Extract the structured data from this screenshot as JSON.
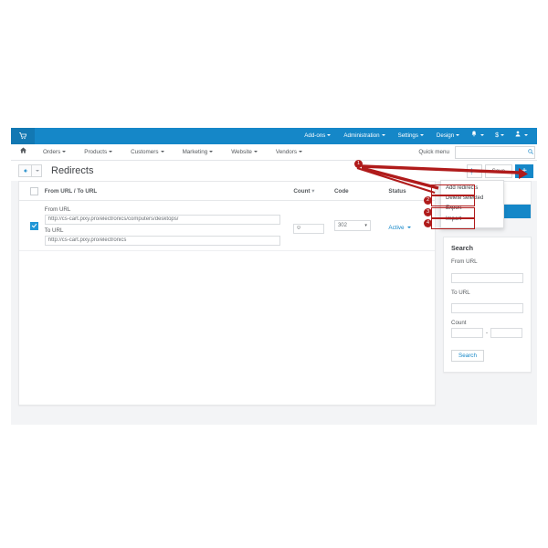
{
  "topbar": {
    "logo_icon": "shopping-cart-icon",
    "menus": [
      {
        "label": "Add-ons",
        "caret": true
      },
      {
        "label": "Administration",
        "caret": true
      },
      {
        "label": "Settings",
        "caret": true
      },
      {
        "label": "Design",
        "caret": true
      }
    ],
    "icons": [
      {
        "name": "bell-icon",
        "glyph": "⚑"
      },
      {
        "name": "currency-icon",
        "glyph": "$"
      },
      {
        "name": "user-icon",
        "glyph": "♟"
      }
    ]
  },
  "mainnav": {
    "home_icon": "home-icon",
    "items": [
      {
        "label": "Orders"
      },
      {
        "label": "Products"
      },
      {
        "label": "Customers"
      },
      {
        "label": "Marketing"
      },
      {
        "label": "Website"
      },
      {
        "label": "Vendors"
      }
    ],
    "quick_menu_label": "Quick menu",
    "quick_search_value": "",
    "quick_search_placeholder": "",
    "search_icon": "search-icon"
  },
  "titlebar": {
    "back_icon": "arrow-left-icon",
    "back_caret_icon": "chevron-down-icon",
    "title": "Redirects",
    "gear_icon": "gear-icon",
    "save_label": "Save",
    "plus_label": "+"
  },
  "dropdown": {
    "items": [
      {
        "label": "Add redirects"
      },
      {
        "label": "Delete selected"
      },
      {
        "label": "Export"
      },
      {
        "label": "Import"
      }
    ]
  },
  "table": {
    "headers": {
      "select_all": "",
      "url": "From URL   / To URL",
      "count": "Count",
      "code": "Code",
      "status": "Status"
    },
    "sort_caret": "▾",
    "rows": [
      {
        "selected": true,
        "from_label": "From URL",
        "from_value": "http://cs-cart.pixy.pro/electronics/computers/desktops/",
        "to_label": "To URL",
        "to_value": "http://cs-cart.pixy.pro/electronics",
        "count": "0",
        "code": "302",
        "status": "Active"
      }
    ]
  },
  "sidebar": {
    "search": {
      "title": "Search",
      "from_url_label": "From URL",
      "from_url_value": "",
      "to_url_label": "To URL",
      "to_url_value": "",
      "count_label": "Count",
      "count_from": "",
      "count_to": "",
      "range_separator": "-",
      "button_label": "Search"
    }
  },
  "annotations": {
    "badges": [
      {
        "number": "1"
      },
      {
        "number": "2"
      },
      {
        "number": "3"
      },
      {
        "number": "4"
      }
    ],
    "color": "#b01b1b"
  },
  "colors": {
    "brand_blue": "#1587c8",
    "brand_blue_dark": "#1278b3",
    "page_bg": "#f3f4f6",
    "annotation_red": "#b01b1b"
  }
}
